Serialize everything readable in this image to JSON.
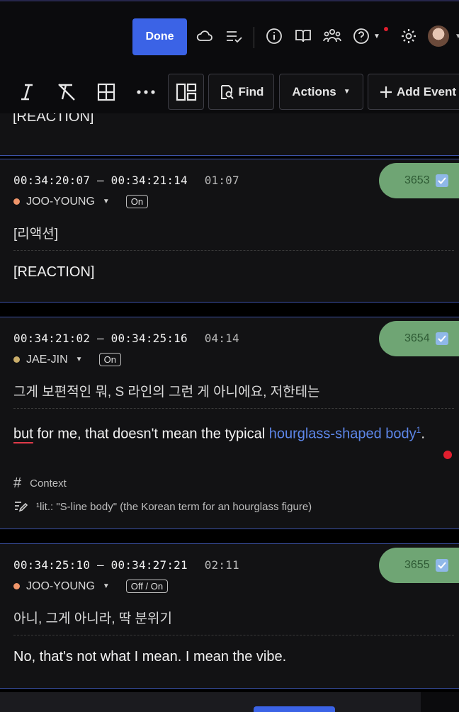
{
  "header": {
    "done_label": "Done",
    "icons": [
      "cloud-icon",
      "checklist-icon",
      "info-icon",
      "book-icon",
      "people-icon",
      "help-icon",
      "settings-icon"
    ]
  },
  "toolbar": {
    "find_label": "Find",
    "actions_label": "Actions",
    "add_event_label": "Add Event"
  },
  "previous_fragment": {
    "text": "[REACTION]"
  },
  "events": [
    {
      "start": "00:34:20:07",
      "end": "00:34:21:14",
      "duration": "01:07",
      "number": "3653",
      "speaker": "JOO-YOUNG",
      "speaker_color": "#f0956a",
      "toggle": "On",
      "source": "[리액션]",
      "target": "[REACTION]"
    },
    {
      "start": "00:34:21:02",
      "end": "00:34:25:16",
      "duration": "04:14",
      "number": "3654",
      "speaker": "JAE-JIN",
      "speaker_color": "#c9ad6a",
      "toggle": "On",
      "source": "그게 보편적인 뭐, S 라인의 그런 게 아니에요, 저한테는",
      "target_parts": {
        "misspelled": "but",
        "plain": " for me, that doesn't mean the typical ",
        "link": "hourglass-shaped body",
        "footnote_mark": "1",
        "end": "."
      },
      "context_label": "Context",
      "note": "¹lit.: \"S-line body\" (the Korean term for an hourglass figure)"
    },
    {
      "start": "00:34:25:10",
      "end": "00:34:27:21",
      "duration": "02:11",
      "number": "3655",
      "speaker": "JOO-YOUNG",
      "speaker_color": "#f0956a",
      "toggle": "Off / On",
      "source": "아니, 그게 아니라, 딱 분위기",
      "target": "No, that's not what I mean. I mean the vibe."
    }
  ],
  "colors": {
    "accent": "#3b63e6",
    "badge": "#6fa574",
    "card_border": "#3d53a8",
    "link": "#5d86e8",
    "error": "#e01e2e"
  }
}
